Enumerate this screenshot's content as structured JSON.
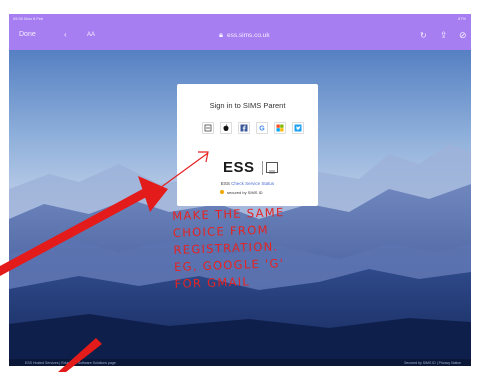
{
  "status_bar": {
    "time": "09:30 Mon 8 Feb",
    "right": "87%"
  },
  "browser": {
    "done_label": "Done",
    "aa_label": "AA",
    "url": "ess.sims.co.uk"
  },
  "signin": {
    "title": "Sign in to SIMS Parent",
    "providers": [
      "sims-id-icon",
      "apple-icon",
      "facebook-icon",
      "google-icon",
      "microsoft-icon",
      "twitter-icon"
    ],
    "ess_logo": "ESS",
    "ess_prefix": "ESS",
    "status_link": "Check Service Status",
    "secured_by": "secured by SIMS ID"
  },
  "footer": {
    "left": "ESS Hosted Services | Education Software Solutions page",
    "right": "Secured by SIMS ID | Privacy Notice"
  },
  "annotation": {
    "lines": [
      "MAKE THE SAME",
      "CHOICE FROM",
      "REGISTRATION.",
      "EG, GOOGLE 'G'",
      "FOR GMAIL"
    ]
  },
  "colors": {
    "browser_bar": "#a77ef2",
    "annotation": "#e62222",
    "card": "#ffffff"
  }
}
